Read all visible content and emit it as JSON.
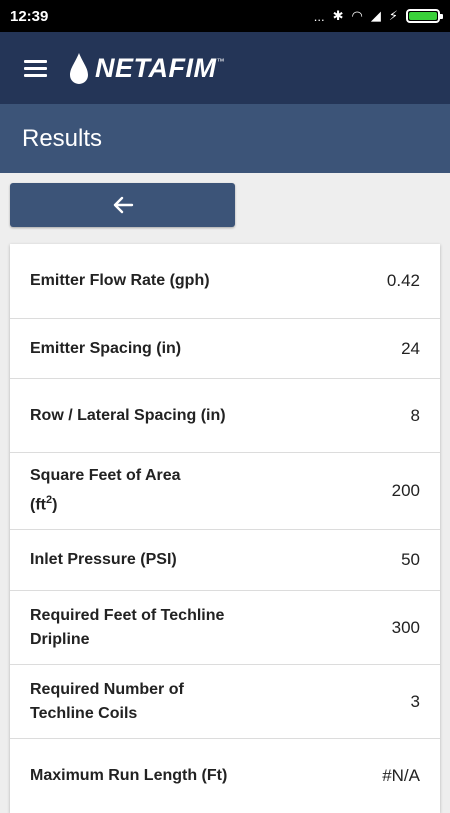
{
  "status_bar": {
    "time": "12:39",
    "dots": "...",
    "bluetooth": "✱",
    "wifi": "◠",
    "signal": "◢",
    "charging": "⚡",
    "accent": "#3ad13a"
  },
  "app_bar": {
    "logo": "NETAFIM",
    "tm": "™"
  },
  "title": "Results",
  "back_icon": "arrow-left-icon",
  "rows": [
    {
      "label": "Emitter Flow Rate (gph)",
      "value": "0.42"
    },
    {
      "label": "Emitter Spacing (in)",
      "value": "24"
    },
    {
      "label": "Row / Lateral Spacing (in)",
      "value": "8"
    },
    {
      "label_main": "Square Feet of Area",
      "label_unit": "(ft",
      "label_sup": "2",
      "label_close": ")",
      "value": "200"
    },
    {
      "label": "Inlet Pressure (PSI)",
      "value": "50"
    },
    {
      "label": "Required Feet of Techline Dripline",
      "value": "300"
    },
    {
      "label": "Required Number of Techline Coils",
      "value": "3"
    },
    {
      "label": "Maximum Run Length (Ft)",
      "value": "#N/A"
    }
  ],
  "colors": {
    "header": "#243557",
    "title_bar": "#3c5478",
    "button": "#3c5478"
  }
}
